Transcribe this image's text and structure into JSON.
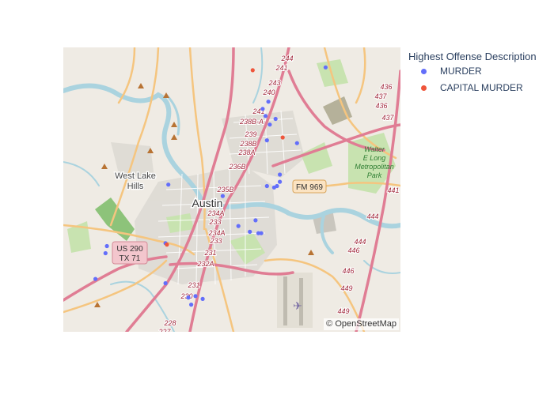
{
  "map": {
    "attribution": "© OpenStreetMap",
    "labels": {
      "city": "Austin",
      "west_lake_line1": "West Lake",
      "west_lake_line2": "Hills",
      "park_line1": "Walter",
      "park_line2": "E Long",
      "park_line3": "Metropolitan",
      "park_line4": "Park"
    },
    "shields": {
      "fm969": "FM 969",
      "us290": "US 290",
      "tx71": "TX 71"
    },
    "exit_numbers": [
      "244",
      "241",
      "243",
      "240",
      "241",
      "238B-A",
      "239",
      "238B",
      "238A",
      "236B",
      "235B",
      "234A",
      "233",
      "234A",
      "233",
      "231",
      "232A",
      "231",
      "230",
      "228",
      "227",
      "436",
      "437",
      "436",
      "437",
      "441",
      "444",
      "444",
      "446",
      "446",
      "449",
      "449"
    ],
    "colors": {
      "land": "#efebe4",
      "water": "#aad3df",
      "park": "#c8e3b0",
      "motorway": "#e07d94",
      "primary": "#f5c57f",
      "urban": "#d5d2cc"
    }
  },
  "legend": {
    "title": "Highest Offense Description",
    "items": [
      {
        "label": "MURDER",
        "color": "#636efa"
      },
      {
        "label": "CAPITAL MURDER",
        "color": "#ef553b"
      }
    ]
  },
  "points": {
    "murder": [
      {
        "lat": 30.393,
        "lon": -97.672
      },
      {
        "lat": 30.369,
        "lon": -97.712
      },
      {
        "lat": 30.364,
        "lon": -97.716
      },
      {
        "lat": 30.359,
        "lon": -97.714
      },
      {
        "lat": 30.357,
        "lon": -97.707
      },
      {
        "lat": 30.353,
        "lon": -97.711
      },
      {
        "lat": 30.342,
        "lon": -97.713
      },
      {
        "lat": 30.34,
        "lon": -97.692
      },
      {
        "lat": 30.318,
        "lon": -97.704
      },
      {
        "lat": 30.313,
        "lon": -97.704
      },
      {
        "lat": 30.31,
        "lon": -97.706
      },
      {
        "lat": 30.309,
        "lon": -97.708
      },
      {
        "lat": 30.31,
        "lon": -97.713
      },
      {
        "lat": 30.311,
        "lon": -97.782
      },
      {
        "lat": 30.303,
        "lon": -97.744
      },
      {
        "lat": 30.286,
        "lon": -97.721
      },
      {
        "lat": 30.282,
        "lon": -97.733
      },
      {
        "lat": 30.277,
        "lon": -97.717
      },
      {
        "lat": 30.277,
        "lon": -97.719
      },
      {
        "lat": 30.278,
        "lon": -97.725
      },
      {
        "lat": 30.27,
        "lon": -97.784
      },
      {
        "lat": 30.268,
        "lon": -97.825
      },
      {
        "lat": 30.263,
        "lon": -97.826
      },
      {
        "lat": 30.245,
        "lon": -97.833
      },
      {
        "lat": 30.242,
        "lon": -97.784
      },
      {
        "lat": 30.232,
        "lon": -97.768
      },
      {
        "lat": 30.231,
        "lon": -97.758
      },
      {
        "lat": 30.233,
        "lon": -97.763
      },
      {
        "lat": 30.227,
        "lon": -97.766
      }
    ],
    "capital_murder": [
      {
        "lat": 30.391,
        "lon": -97.723
      },
      {
        "lat": 30.344,
        "lon": -97.702
      },
      {
        "lat": 30.269,
        "lon": -97.783
      }
    ]
  }
}
